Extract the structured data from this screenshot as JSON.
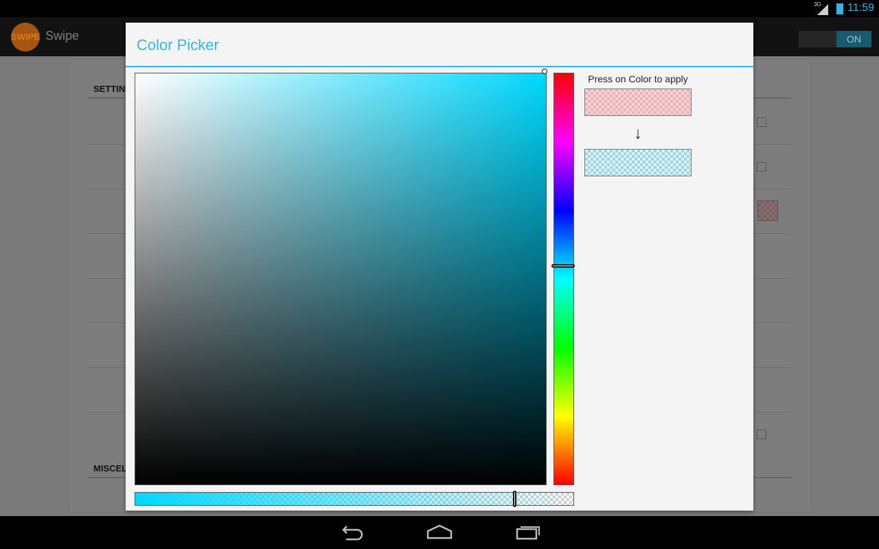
{
  "status_bar": {
    "network": "3G",
    "time": "11:59"
  },
  "app": {
    "logo_text": "SWIPE",
    "title": "Swipe",
    "toggle_label": "ON"
  },
  "background": {
    "section1": "SETTIN",
    "section2": "MISCEL"
  },
  "dialog": {
    "title": "Color Picker",
    "hint": "Press on Color to apply",
    "arrow": "↓"
  },
  "colors": {
    "accent": "#33b5e5",
    "selected_hue": "#00d8ff",
    "old_color": "#ff8282",
    "new_color": "#00d8ff"
  },
  "icons": [
    "signal-icon",
    "battery-icon",
    "back-icon",
    "home-icon",
    "recents-icon",
    "down-arrow-icon"
  ]
}
